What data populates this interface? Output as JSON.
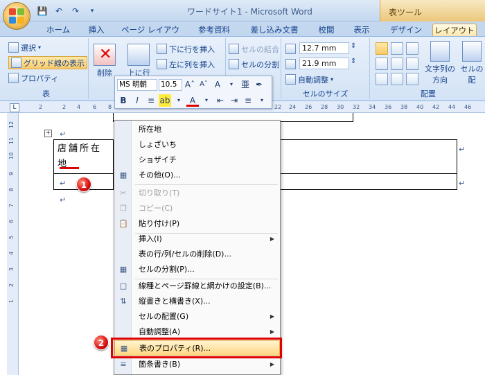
{
  "window": {
    "title": "ワードサイト1 - Microsoft Word",
    "context_title": "表ツール"
  },
  "quick_access": {
    "save_icon": "save-icon",
    "undo_icon": "undo-icon",
    "redo_icon": "redo-icon",
    "customize_icon": "chevron-down-icon"
  },
  "tabs": [
    {
      "label": "ホーム"
    },
    {
      "label": "挿入"
    },
    {
      "label": "ページ レイアウト"
    },
    {
      "label": "参考資料"
    },
    {
      "label": "差し込み文書"
    },
    {
      "label": "校閲"
    },
    {
      "label": "表示"
    },
    {
      "label": "デザイン"
    },
    {
      "label": "レイアウト"
    }
  ],
  "ribbon": {
    "table_group": {
      "select_label": "選択",
      "gridlines_label": "グリッド線の表示",
      "properties_label": "プロパティ",
      "group_label": "表"
    },
    "rows_group": {
      "delete_label": "削除",
      "insert_above_label": "上に行",
      "insert_below_label": "下に行を挿入",
      "insert_left_label": "左に列を挿入"
    },
    "merge_group": {
      "merge_label": "セルの結合",
      "split_cells_label": "セルの分割"
    },
    "size_group": {
      "height_value": "12.7 mm",
      "width_value": "21.9 mm",
      "autofit_label": "自動調整",
      "group_label": "セルのサイズ"
    },
    "alignment_group": {
      "text_direction_label": "文字列の",
      "text_direction_label2": "方向",
      "cell_margins_label": "セルの",
      "cell_margins_label2": "配",
      "group_label": "配置"
    }
  },
  "ruler": {
    "top_ticks": [
      "2",
      "2",
      "4",
      "6",
      "8",
      "22",
      "24",
      "26",
      "28",
      "30",
      "32",
      "34",
      "36",
      "38",
      "40",
      "42",
      "44",
      "46"
    ],
    "left_ticks": [
      "12",
      "11",
      "10",
      "9",
      "8",
      "7",
      "6",
      "5",
      "4",
      "3",
      "2",
      "1"
    ],
    "corner_label": "L"
  },
  "mini_toolbar": {
    "font_name": "MS 明朝",
    "font_size": "10.5"
  },
  "document": {
    "cell_text": "店舗所在地",
    "para_mark": "↵"
  },
  "badges": {
    "one": "1",
    "two": "2"
  },
  "context_menu": {
    "items": [
      {
        "label": "所在地",
        "icon": "",
        "disabled": false,
        "submenu": false
      },
      {
        "label": "しょざいち",
        "icon": "",
        "disabled": false,
        "submenu": false
      },
      {
        "label": "ショザイチ",
        "icon": "",
        "disabled": false,
        "submenu": false
      },
      {
        "label": "その他(O)...",
        "icon": "ime-icon",
        "disabled": false,
        "submenu": false
      },
      {
        "label": "切り取り(T)",
        "icon": "cut-icon",
        "disabled": true,
        "submenu": false
      },
      {
        "label": "コピー(C)",
        "icon": "copy-icon",
        "disabled": true,
        "submenu": false
      },
      {
        "label": "貼り付け(P)",
        "icon": "paste-icon",
        "disabled": false,
        "submenu": false
      },
      {
        "label": "挿入(I)",
        "icon": "",
        "disabled": false,
        "submenu": true
      },
      {
        "label": "表の行/列/セルの削除(D)...",
        "icon": "",
        "disabled": false,
        "submenu": false
      },
      {
        "label": "セルの分割(P)...",
        "icon": "split-cells-icon",
        "disabled": false,
        "submenu": false
      },
      {
        "label": "線種とページ罫線と網かけの設定(B)...",
        "icon": "borders-icon",
        "disabled": false,
        "submenu": false
      },
      {
        "label": "縦書きと横書き(X)...",
        "icon": "text-direction-icon",
        "disabled": false,
        "submenu": false
      },
      {
        "label": "セルの配置(G)",
        "icon": "",
        "disabled": false,
        "submenu": true
      },
      {
        "label": "自動調整(A)",
        "icon": "",
        "disabled": false,
        "submenu": true
      },
      {
        "label": "表のプロパティ(R)...",
        "icon": "table-properties-icon",
        "disabled": false,
        "submenu": false
      },
      {
        "label": "箇条書き(B)",
        "icon": "bullets-icon",
        "disabled": false,
        "submenu": true
      }
    ]
  },
  "colors": {
    "accent_red": "#e00000",
    "ribbon_blue": "#15428b",
    "highlight_gold": "#f9c96a"
  }
}
